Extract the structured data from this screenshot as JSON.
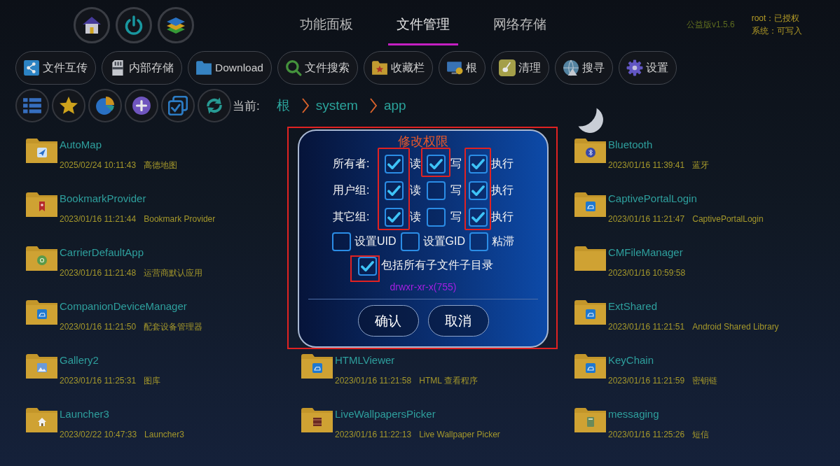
{
  "tabs": [
    {
      "label": "功能面板",
      "selected": false
    },
    {
      "label": "文件管理",
      "selected": true
    },
    {
      "label": "网络存储",
      "selected": false
    }
  ],
  "version": "公益版v1.5.6",
  "status": [
    "root：已授权",
    "系统：可写入"
  ],
  "toolbar": [
    "文件互传",
    "内部存储",
    "Download",
    "文件搜索",
    "收藏栏",
    "根",
    "清理",
    "搜寻",
    "设置"
  ],
  "path": {
    "label": "当前:",
    "crumbs": [
      "根",
      "system",
      "app"
    ]
  },
  "file_columns": [
    {
      "files": [
        {
          "name": "AutoMap",
          "modified": "2025/02/24 10:11:43",
          "description": "高德地图"
        },
        {
          "name": "BookmarkProvider",
          "modified": "2023/01/16 11:21:44",
          "description": "Bookmark Provider"
        },
        {
          "name": "CarrierDefaultApp",
          "modified": "2023/01/16 11:21:48",
          "description": "运营商默认应用"
        },
        {
          "name": "CompanionDeviceManager",
          "modified": "2023/01/16 11:21:50",
          "description": "配套设备管理器"
        },
        {
          "name": "Gallery2",
          "modified": "2023/01/16 11:25:31",
          "description": "图库"
        },
        {
          "name": "Launcher3",
          "modified": "2023/02/22 10:47:33",
          "description": "Launcher3"
        }
      ]
    },
    {
      "files": [
        {
          "name": "HTMLViewer",
          "modified": "2023/01/16 11:21:58",
          "description": "HTML 查看程序"
        },
        {
          "name": "LiveWallpapersPicker",
          "modified": "2023/01/16 11:22:13",
          "description": "Live Wallpaper Picker"
        }
      ]
    },
    {
      "files": [
        {
          "name": "Bluetooth",
          "modified": "2023/01/16 11:39:41",
          "description": "蓝牙"
        },
        {
          "name": "CaptivePortalLogin",
          "modified": "2023/01/16 11:21:47",
          "description": "CaptivePortalLogin"
        },
        {
          "name": "CMFileManager",
          "modified": "2023/01/16 10:59:58"
        },
        {
          "name": "ExtShared",
          "modified": "2023/01/16 11:21:51",
          "description": "Android Shared Library"
        },
        {
          "name": "KeyChain",
          "modified": "2023/01/16 11:21:59",
          "description": "密钥链"
        },
        {
          "name": "messaging",
          "modified": "2023/01/16 11:25:26",
          "description": "短信"
        }
      ]
    }
  ],
  "dialog": {
    "title": "修改权限",
    "highlighted": true,
    "groups": [
      {
        "label": "所有者:",
        "perms": [
          {
            "label": "读",
            "checked": true,
            "highlighted": true
          },
          {
            "label": "写",
            "checked": true,
            "highlighted": true
          },
          {
            "label": "执行",
            "checked": true,
            "highlighted": true
          }
        ]
      },
      {
        "label": "用户组:",
        "perms": [
          {
            "label": "读",
            "checked": true,
            "highlighted": true
          },
          {
            "label": "写",
            "checked": false,
            "highlighted": false
          },
          {
            "label": "执行",
            "checked": true,
            "highlighted": true
          }
        ]
      },
      {
        "label": "其它组:",
        "perms": [
          {
            "label": "读",
            "checked": true,
            "highlighted": true
          },
          {
            "label": "写",
            "checked": false,
            "highlighted": false
          },
          {
            "label": "执行",
            "checked": true,
            "highlighted": true
          }
        ]
      }
    ],
    "special": [
      {
        "label": "设置UID",
        "checked": false
      },
      {
        "label": "设置GID",
        "checked": false
      },
      {
        "label": "粘滞",
        "checked": false
      }
    ],
    "recursive": {
      "label": "包括所有子文件子目录",
      "checked": true,
      "highlighted": true
    },
    "mode": "drwxr-xr-x(755)",
    "buttons": [
      "确认",
      "取消"
    ]
  }
}
